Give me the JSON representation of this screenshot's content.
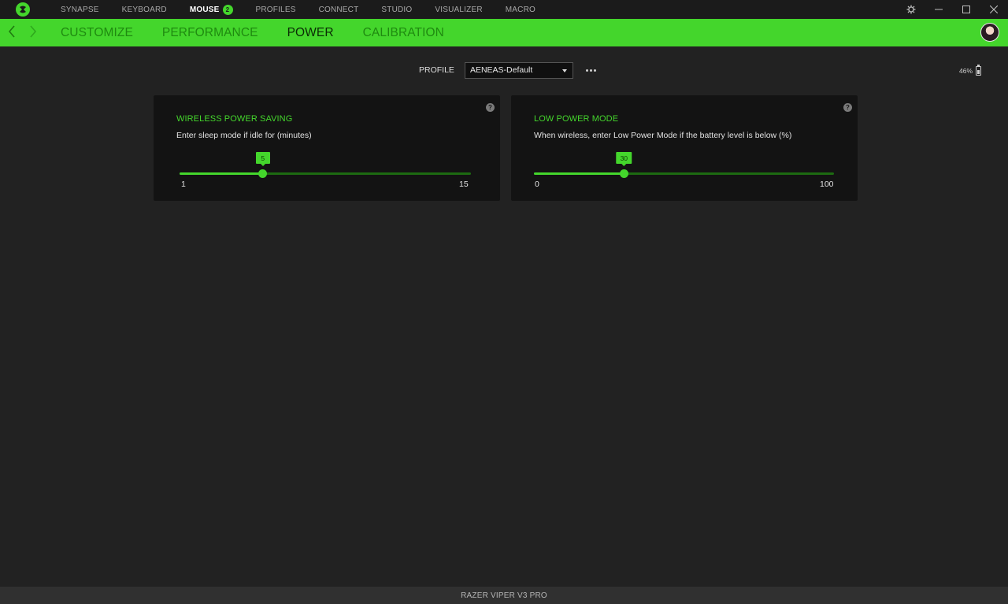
{
  "titlebar": {
    "nav": [
      {
        "label": "SYNAPSE"
      },
      {
        "label": "KEYBOARD"
      },
      {
        "label": "MOUSE",
        "badge": "2",
        "active": true
      },
      {
        "label": "PROFILES"
      },
      {
        "label": "CONNECT"
      },
      {
        "label": "STUDIO"
      },
      {
        "label": "VISUALIZER"
      },
      {
        "label": "MACRO"
      }
    ]
  },
  "subnav": {
    "tabs": [
      {
        "label": "CUSTOMIZE"
      },
      {
        "label": "PERFORMANCE"
      },
      {
        "label": "POWER",
        "active": true
      },
      {
        "label": "CALIBRATION"
      }
    ]
  },
  "profile": {
    "label": "PROFILE",
    "selected": "AENEAS-Default"
  },
  "battery": {
    "text": "46%",
    "level": 46
  },
  "cards": {
    "wireless": {
      "title": "WIRELESS POWER SAVING",
      "desc": "Enter sleep mode if idle for (minutes)",
      "min": "1",
      "max": "15",
      "value": "5"
    },
    "lowpower": {
      "title": "LOW POWER MODE",
      "desc": "When wireless, enter Low Power Mode if the battery level is below (%)",
      "min": "0",
      "max": "100",
      "value": "30"
    }
  },
  "footer": {
    "device": "RAZER VIPER V3 PRO"
  },
  "colors": {
    "accent": "#44d62c",
    "background": "#222222",
    "card": "#131313"
  }
}
